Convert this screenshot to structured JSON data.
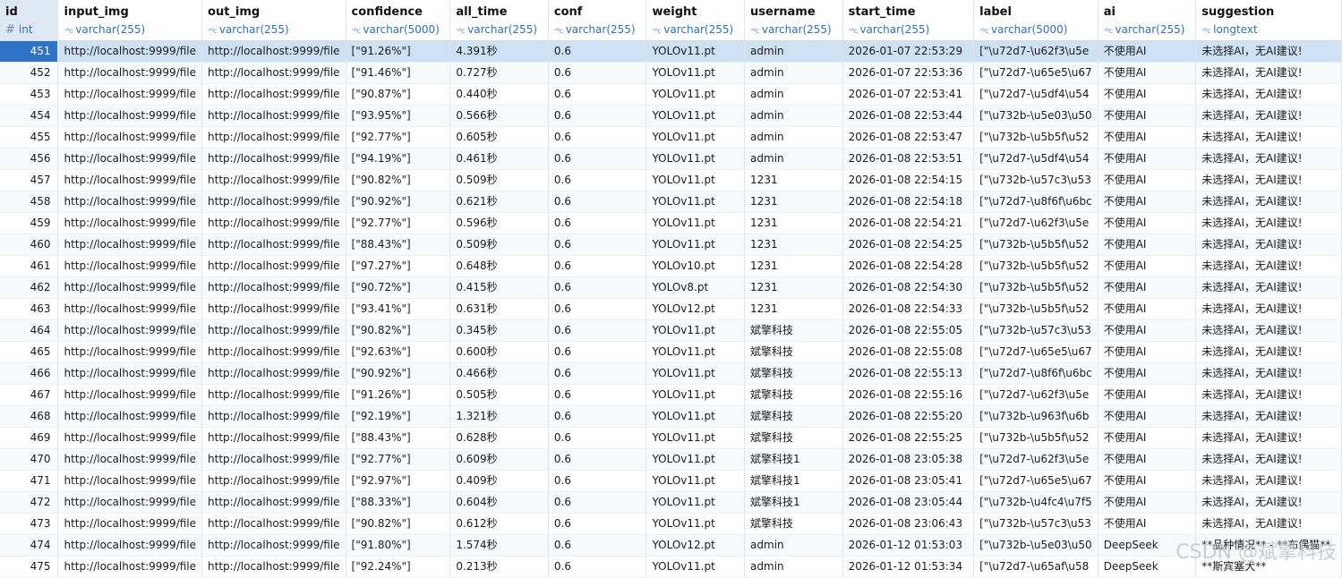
{
  "columns": [
    {
      "name": "id",
      "type": "int",
      "typeIcon": "#"
    },
    {
      "name": "input_img",
      "type": "varchar(255)",
      "typeIcon": "ABC"
    },
    {
      "name": "out_img",
      "type": "varchar(255)",
      "typeIcon": "ABC"
    },
    {
      "name": "confidence",
      "type": "varchar(5000)",
      "typeIcon": "ABC"
    },
    {
      "name": "all_time",
      "type": "varchar(255)",
      "typeIcon": "ABC"
    },
    {
      "name": "conf",
      "type": "varchar(255)",
      "typeIcon": "ABC"
    },
    {
      "name": "weight",
      "type": "varchar(255)",
      "typeIcon": "ABC"
    },
    {
      "name": "username",
      "type": "varchar(255)",
      "typeIcon": "ABC"
    },
    {
      "name": "start_time",
      "type": "varchar(255)",
      "typeIcon": "ABC"
    },
    {
      "name": "label",
      "type": "varchar(5000)",
      "typeIcon": "ABC"
    },
    {
      "name": "ai",
      "type": "varchar(255)",
      "typeIcon": "ABC"
    },
    {
      "name": "suggestion",
      "type": "longtext",
      "typeIcon": "ABC"
    }
  ],
  "selected_row": 0,
  "rows": [
    [
      "451",
      "http://localhost:9999/file",
      "http://localhost:9999/file",
      "[\"91.26%\"]",
      "4.391秒",
      "0.6",
      "YOLOv11.pt",
      "admin",
      "2026-01-07 22:53:29",
      "[\"\\u72d7-\\u62f3\\u5e",
      "不使用AI",
      "未选择AI，无AI建议!"
    ],
    [
      "452",
      "http://localhost:9999/file",
      "http://localhost:9999/file",
      "[\"91.46%\"]",
      "0.727秒",
      "0.6",
      "YOLOv11.pt",
      "admin",
      "2026-01-07 22:53:36",
      "[\"\\u72d7-\\u65e5\\u67",
      "不使用AI",
      "未选择AI，无AI建议!"
    ],
    [
      "453",
      "http://localhost:9999/file",
      "http://localhost:9999/file",
      "[\"90.87%\"]",
      "0.440秒",
      "0.6",
      "YOLOv11.pt",
      "admin",
      "2026-01-07 22:53:41",
      "[\"\\u72d7-\\u5df4\\u54",
      "不使用AI",
      "未选择AI，无AI建议!"
    ],
    [
      "454",
      "http://localhost:9999/file",
      "http://localhost:9999/file",
      "[\"93.95%\"]",
      "0.566秒",
      "0.6",
      "YOLOv11.pt",
      "admin",
      "2026-01-08 22:53:44",
      "[\"\\u732b-\\u5e03\\u50",
      "不使用AI",
      "未选择AI，无AI建议!"
    ],
    [
      "455",
      "http://localhost:9999/file",
      "http://localhost:9999/file",
      "[\"92.77%\"]",
      "0.605秒",
      "0.6",
      "YOLOv11.pt",
      "admin",
      "2026-01-08 22:53:47",
      "[\"\\u732b-\\u5b5f\\u52",
      "不使用AI",
      "未选择AI，无AI建议!"
    ],
    [
      "456",
      "http://localhost:9999/file",
      "http://localhost:9999/file",
      "[\"94.19%\"]",
      "0.461秒",
      "0.6",
      "YOLOv11.pt",
      "admin",
      "2026-01-08 22:53:51",
      "[\"\\u72d7-\\u5df4\\u54",
      "不使用AI",
      "未选择AI，无AI建议!"
    ],
    [
      "457",
      "http://localhost:9999/file",
      "http://localhost:9999/file",
      "[\"90.82%\"]",
      "0.509秒",
      "0.6",
      "YOLOv11.pt",
      "1231",
      "2026-01-08 22:54:15",
      "[\"\\u732b-\\u57c3\\u53",
      "不使用AI",
      "未选择AI，无AI建议!"
    ],
    [
      "458",
      "http://localhost:9999/file",
      "http://localhost:9999/file",
      "[\"90.92%\"]",
      "0.621秒",
      "0.6",
      "YOLOv11.pt",
      "1231",
      "2026-01-08 22:54:18",
      "[\"\\u72d7-\\u8f6f\\u6bc",
      "不使用AI",
      "未选择AI，无AI建议!"
    ],
    [
      "459",
      "http://localhost:9999/file",
      "http://localhost:9999/file",
      "[\"92.77%\"]",
      "0.596秒",
      "0.6",
      "YOLOv11.pt",
      "1231",
      "2026-01-08 22:54:21",
      "[\"\\u72d7-\\u62f3\\u5e",
      "不使用AI",
      "未选择AI，无AI建议!"
    ],
    [
      "460",
      "http://localhost:9999/file",
      "http://localhost:9999/file",
      "[\"88.43%\"]",
      "0.509秒",
      "0.6",
      "YOLOv11.pt",
      "1231",
      "2026-01-08 22:54:25",
      "[\"\\u732b-\\u5b5f\\u52",
      "不使用AI",
      "未选择AI，无AI建议!"
    ],
    [
      "461",
      "http://localhost:9999/file",
      "http://localhost:9999/file",
      "[\"97.27%\"]",
      "0.648秒",
      "0.6",
      "YOLOv10.pt",
      "1231",
      "2026-01-08 22:54:28",
      "[\"\\u732b-\\u5b5f\\u52",
      "不使用AI",
      "未选择AI，无AI建议!"
    ],
    [
      "462",
      "http://localhost:9999/file",
      "http://localhost:9999/file",
      "[\"90.72%\"]",
      "0.415秒",
      "0.6",
      "YOLOv8.pt",
      "1231",
      "2026-01-08 22:54:30",
      "[\"\\u732b-\\u5b5f\\u52",
      "不使用AI",
      "未选择AI，无AI建议!"
    ],
    [
      "463",
      "http://localhost:9999/file",
      "http://localhost:9999/file",
      "[\"93.41%\"]",
      "0.631秒",
      "0.6",
      "YOLOv12.pt",
      "1231",
      "2026-01-08 22:54:33",
      "[\"\\u732b-\\u5b5f\\u52",
      "不使用AI",
      "未选择AI，无AI建议!"
    ],
    [
      "464",
      "http://localhost:9999/file",
      "http://localhost:9999/file",
      "[\"90.82%\"]",
      "0.345秒",
      "0.6",
      "YOLOv11.pt",
      "斌擎科技",
      "2026-01-08 22:55:05",
      "[\"\\u732b-\\u57c3\\u53",
      "不使用AI",
      "未选择AI，无AI建议!"
    ],
    [
      "465",
      "http://localhost:9999/file",
      "http://localhost:9999/file",
      "[\"92.63%\"]",
      "0.600秒",
      "0.6",
      "YOLOv11.pt",
      "斌擎科技",
      "2026-01-08 22:55:08",
      "[\"\\u72d7-\\u65e5\\u67",
      "不使用AI",
      "未选择AI，无AI建议!"
    ],
    [
      "466",
      "http://localhost:9999/file",
      "http://localhost:9999/file",
      "[\"90.92%\"]",
      "0.466秒",
      "0.6",
      "YOLOv11.pt",
      "斌擎科技",
      "2026-01-08 22:55:13",
      "[\"\\u72d7-\\u8f6f\\u6bc",
      "不使用AI",
      "未选择AI，无AI建议!"
    ],
    [
      "467",
      "http://localhost:9999/file",
      "http://localhost:9999/file",
      "[\"91.26%\"]",
      "0.505秒",
      "0.6",
      "YOLOv11.pt",
      "斌擎科技",
      "2026-01-08 22:55:16",
      "[\"\\u72d7-\\u62f3\\u5e",
      "不使用AI",
      "未选择AI，无AI建议!"
    ],
    [
      "468",
      "http://localhost:9999/file",
      "http://localhost:9999/file",
      "[\"92.19%\"]",
      "1.321秒",
      "0.6",
      "YOLOv11.pt",
      "斌擎科技",
      "2026-01-08 22:55:20",
      "[\"\\u732b-\\u963f\\u6b",
      "不使用AI",
      "未选择AI，无AI建议!"
    ],
    [
      "469",
      "http://localhost:9999/file",
      "http://localhost:9999/file",
      "[\"88.43%\"]",
      "0.628秒",
      "0.6",
      "YOLOv11.pt",
      "斌擎科技",
      "2026-01-08 22:55:25",
      "[\"\\u732b-\\u5b5f\\u52",
      "不使用AI",
      "未选择AI，无AI建议!"
    ],
    [
      "470",
      "http://localhost:9999/file",
      "http://localhost:9999/file",
      "[\"92.77%\"]",
      "0.609秒",
      "0.6",
      "YOLOv11.pt",
      "斌擎科技1",
      "2026-01-08 23:05:38",
      "[\"\\u72d7-\\u62f3\\u5e",
      "不使用AI",
      "未选择AI，无AI建议!"
    ],
    [
      "471",
      "http://localhost:9999/file",
      "http://localhost:9999/file",
      "[\"92.97%\"]",
      "0.409秒",
      "0.6",
      "YOLOv11.pt",
      "斌擎科技1",
      "2026-01-08 23:05:41",
      "[\"\\u72d7-\\u65e5\\u67",
      "不使用AI",
      "未选择AI，无AI建议!"
    ],
    [
      "472",
      "http://localhost:9999/file",
      "http://localhost:9999/file",
      "[\"88.33%\"]",
      "0.604秒",
      "0.6",
      "YOLOv11.pt",
      "斌擎科技1",
      "2026-01-08 23:05:44",
      "[\"\\u732b-\\u4fc4\\u7f5",
      "不使用AI",
      "未选择AI，无AI建议!"
    ],
    [
      "473",
      "http://localhost:9999/file",
      "http://localhost:9999/file",
      "[\"90.82%\"]",
      "0.612秒",
      "0.6",
      "YOLOv11.pt",
      "斌擎科技",
      "2026-01-08 23:06:43",
      "[\"\\u732b-\\u57c3\\u53",
      "不使用AI",
      "未选择AI，无AI建议!"
    ],
    [
      "474",
      "http://localhost:9999/file",
      "http://localhost:9999/file",
      "[\"91.80%\"]",
      "1.574秒",
      "0.6",
      "YOLOv12.pt",
      "admin",
      "2026-01-12 01:53:03",
      "[\"\\u732b-\\u5e03\\u50",
      "DeepSeek",
      "**品种情况** - **布偶猫**"
    ],
    [
      "475",
      "http://localhost:9999/file",
      "http://localhost:9999/file",
      "[\"92.24%\"]",
      "0.213秒",
      "0.6",
      "YOLOv11.pt",
      "admin",
      "2026-01-12 01:53:34",
      "[\"\\u72d7-\\u65af\\u58",
      "DeepSeek",
      "**斯宾塞犬**"
    ]
  ],
  "watermark": "CSDN @斌擎科技"
}
